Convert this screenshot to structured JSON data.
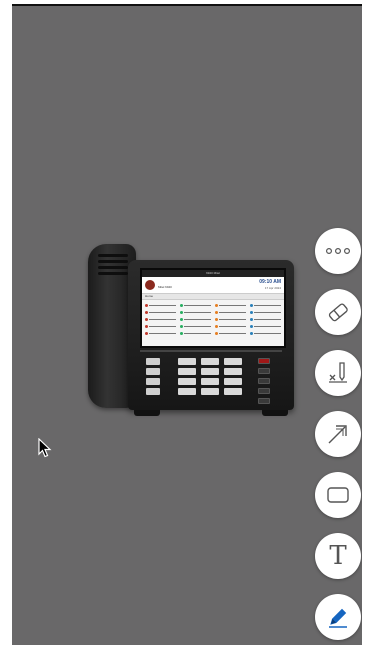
{
  "phone_screen": {
    "clock": "09:10 AM",
    "date": "17 Apr 2024",
    "user": "Mitel 6940",
    "tab": "Home",
    "status": "6940 Mitel"
  },
  "phone_screen_key_colors": [
    "#c0392b",
    "#27ae60",
    "#e67e22",
    "#2980b9"
  ],
  "toolbar": {
    "items": [
      {
        "name": "more-options-button",
        "icon": "more-icon"
      },
      {
        "name": "eraser-button",
        "icon": "eraser-icon"
      },
      {
        "name": "clear-all-button",
        "icon": "clear-ink-icon"
      },
      {
        "name": "pointer-arrow-button",
        "icon": "arrow-icon"
      },
      {
        "name": "rectangle-button",
        "icon": "rectangle-icon"
      },
      {
        "name": "text-button",
        "icon": "text-icon",
        "label": "T"
      },
      {
        "name": "pen-button",
        "icon": "pen-icon",
        "accent": "#1565c0"
      }
    ]
  },
  "colors": {
    "viewport_bg": "#696869",
    "tool_bg": "#ffffff",
    "tool_icon": "#555555",
    "pen_accent": "#1565c0"
  }
}
